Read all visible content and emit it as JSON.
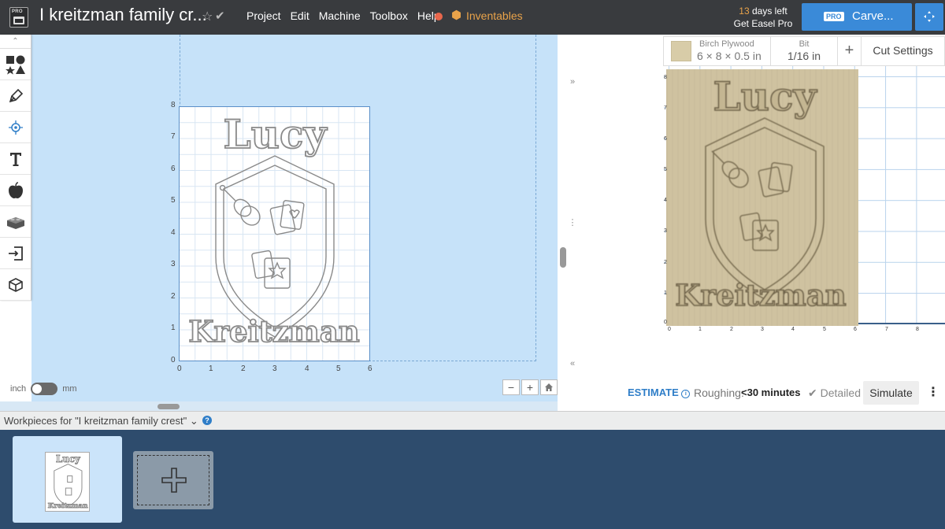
{
  "header": {
    "logo_pro": "PRO",
    "title": "I kreitzman family cr...",
    "menu": [
      "Project",
      "Edit",
      "Machine",
      "Toolbox",
      "Help"
    ],
    "inventables": "Inventables",
    "trial_days": "13",
    "trial_days_suffix": " days left",
    "trial_cta": "Get Easel Pro",
    "carve_pro_tag": "PRO",
    "carve_label": "Carve..."
  },
  "toolbar": {
    "items": [
      "shapes-icon",
      "pen-icon",
      "point-icon",
      "text-icon",
      "apple-icon",
      "lego-brick-icon",
      "import-icon",
      "3d-box-icon"
    ]
  },
  "design": {
    "y_ticks": [
      "8",
      "7",
      "6",
      "5",
      "4",
      "3",
      "2",
      "1",
      "0"
    ],
    "x_ticks": [
      "0",
      "1",
      "2",
      "3",
      "4",
      "5",
      "6"
    ],
    "crest_top_text": "Lucy",
    "crest_bottom_text": "Kreitzman",
    "unit_left": "inch",
    "unit_right": "mm",
    "unit_selected": "inch"
  },
  "material": {
    "name": "Birch Plywood",
    "size": "6 × 8 × 0.5 in",
    "bit_label": "Bit",
    "bit_size": "1/16 in",
    "add_bit": "+",
    "cut_settings": "Cut Settings"
  },
  "preview": {
    "y_ticks": [
      "8",
      "7",
      "6",
      "5",
      "4",
      "3",
      "2",
      "1",
      "0"
    ],
    "x_ticks": [
      "0",
      "1",
      "2",
      "3",
      "4",
      "5",
      "6",
      "7",
      "8"
    ]
  },
  "estimate": {
    "label": "ESTIMATE",
    "roughing_label": "Roughing:",
    "roughing_value": "<30 minutes",
    "detailed": "Detailed",
    "simulate": "Simulate"
  },
  "workpieces": {
    "header": "Workpieces for \"I kreitzman family crest\"",
    "thumb_top_text": "Lucy",
    "thumb_bottom_text": "Kreitzman"
  },
  "colors": {
    "topbar": "#393b3e",
    "accent_blue": "#3a8ad8",
    "inventables_orange": "#e9a34a",
    "canvas_bg": "#c6e2f9",
    "wood": "#cfc2a0",
    "panel_navy": "#2e4c6d"
  }
}
